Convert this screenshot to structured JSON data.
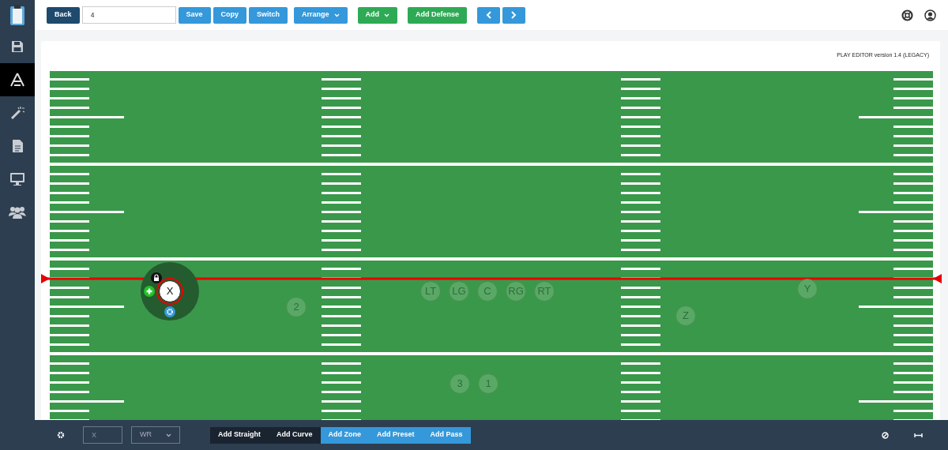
{
  "sidebar": {
    "items": [
      {
        "kind": "logo",
        "selected": false
      },
      {
        "kind": "save",
        "selected": false
      },
      {
        "kind": "editor",
        "selected": true
      },
      {
        "kind": "wand",
        "selected": false
      },
      {
        "kind": "document",
        "selected": false
      },
      {
        "kind": "monitor",
        "selected": false
      },
      {
        "kind": "team",
        "selected": false
      }
    ]
  },
  "toolbar": {
    "items": [
      {
        "kind": "back",
        "label": "Back"
      },
      {
        "kind": "input",
        "value": "4"
      },
      {
        "kind": "button",
        "label": "Save"
      },
      {
        "kind": "button",
        "label": "Copy"
      },
      {
        "kind": "button",
        "label": "Switch"
      },
      {
        "kind": "dropdown",
        "label": "Arrange"
      },
      {
        "kind": "add-dropdown",
        "label": "Add"
      },
      {
        "kind": "add",
        "label": "Add Defense"
      },
      {
        "kind": "prev"
      },
      {
        "kind": "next"
      }
    ],
    "right_icons": [
      {
        "kind": "help"
      },
      {
        "kind": "account"
      }
    ]
  },
  "editor": {
    "version": "PLAY EDITOR version 1.4 (LEGACY)",
    "players": [
      {
        "label": "X",
        "selected": true
      },
      {
        "label": "2",
        "selected": false
      },
      {
        "label": "LT",
        "selected": false
      },
      {
        "label": "LG",
        "selected": false
      },
      {
        "label": "C",
        "selected": false
      },
      {
        "label": "RG",
        "selected": false
      },
      {
        "label": "RT",
        "selected": false
      },
      {
        "label": "Y",
        "selected": false
      },
      {
        "label": "Z",
        "selected": false
      },
      {
        "label": "3",
        "selected": false
      },
      {
        "label": "1",
        "selected": false
      }
    ]
  },
  "bottom_bar": {
    "label_placeholder": "X",
    "position": "WR",
    "route_buttons": [
      {
        "label": "Add Straight",
        "kind": "line"
      },
      {
        "label": "Add Curve",
        "kind": "line"
      },
      {
        "label": "Add Zone",
        "kind": "action"
      },
      {
        "label": "Add Preset",
        "kind": "action"
      },
      {
        "label": "Add Pass",
        "kind": "action"
      }
    ]
  }
}
